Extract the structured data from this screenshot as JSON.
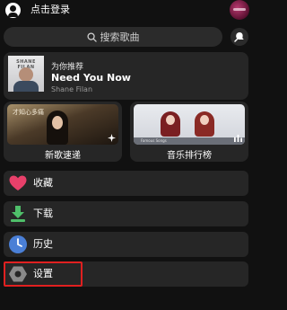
{
  "header": {
    "login_label": "点击登录"
  },
  "search": {
    "placeholder": "搜索歌曲"
  },
  "recommend": {
    "tag": "为你推荐",
    "title": "Need You Now",
    "artist": "Shane Filan",
    "cover_text": "SHANE FILAN"
  },
  "cards": [
    {
      "label": "新歌速递",
      "cover_text": "才知心多痛"
    },
    {
      "label": "音乐排行榜",
      "cover_text": "Famous Songs"
    }
  ],
  "menu": [
    {
      "label": "收藏",
      "icon": "heart-icon",
      "color": "#e8406a"
    },
    {
      "label": "下载",
      "icon": "download-icon",
      "color": "#4fbf6a"
    },
    {
      "label": "历史",
      "icon": "clock-icon",
      "color": "#4a7fd6"
    },
    {
      "label": "设置",
      "icon": "gear-icon",
      "color": "#8a8a8a"
    }
  ],
  "colors": {
    "background": "#111111",
    "panel": "#262626",
    "highlight": "#e02020"
  }
}
